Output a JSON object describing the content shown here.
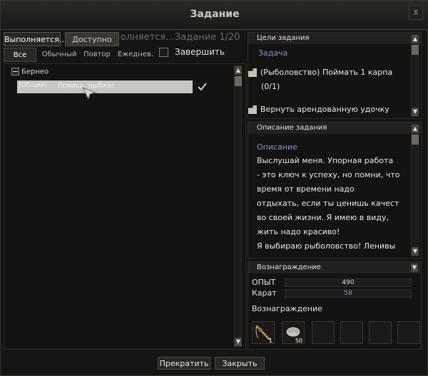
{
  "window": {
    "title": "Задание",
    "close_label": "x"
  },
  "tabs": [
    {
      "label": "Выполняется...",
      "active": true
    },
    {
      "label": "Доступно",
      "active": false
    }
  ],
  "ghost_header": {
    "left": "олняется...",
    "right": "Задание 1/20"
  },
  "filters": [
    {
      "label": "Все",
      "active": true
    },
    {
      "label": "Обычный",
      "active": false
    },
    {
      "label": "Повтор",
      "active": false
    },
    {
      "label": "Ежеднев.",
      "active": false
    }
  ],
  "complete_label": "Завершить",
  "quest_list": {
    "group": "Бернео",
    "quests": [
      {
        "tag": "[Общий]",
        "name": "Ловись, рыбка!",
        "checked": true
      }
    ]
  },
  "objectives": {
    "header": "Цели задания",
    "subtitle": "Задача",
    "items": [
      {
        "text": "(Рыболовство) Поймать 1 карпа",
        "progress": "(0/1)"
      },
      {
        "text": "Вернуть арендованную удочку"
      }
    ]
  },
  "description": {
    "header": "Описание задания",
    "subtitle": "Описание",
    "lines": [
      "Выслушай меня. Упорная работа",
      "- это ключ к успеху, но помни, что",
      "время от времени надо",
      "отдыхать, если ты ценишь качест",
      "во своей жизни. Я имею в виду,",
      "жить надо красиво!",
      "Я выбираю рыболовство! Ленивы"
    ]
  },
  "rewards": {
    "header": "Вознаграждение",
    "exp_label": "ОПЫТ",
    "exp_value": "490",
    "carat_label": "Карат",
    "carat_value": "58",
    "items_label": "Вознаграждение",
    "slots": [
      {
        "icon": "fishing-rod-icon",
        "count": "1"
      },
      {
        "icon": "shell-icon",
        "count": "50"
      },
      {
        "icon": "",
        "count": ""
      },
      {
        "icon": "",
        "count": ""
      },
      {
        "icon": "",
        "count": ""
      },
      {
        "icon": "",
        "count": ""
      }
    ],
    "colors": {
      "carat": "#7f94cf"
    }
  },
  "buttons": {
    "abort": "Прекратить",
    "close": "Закрыть"
  }
}
